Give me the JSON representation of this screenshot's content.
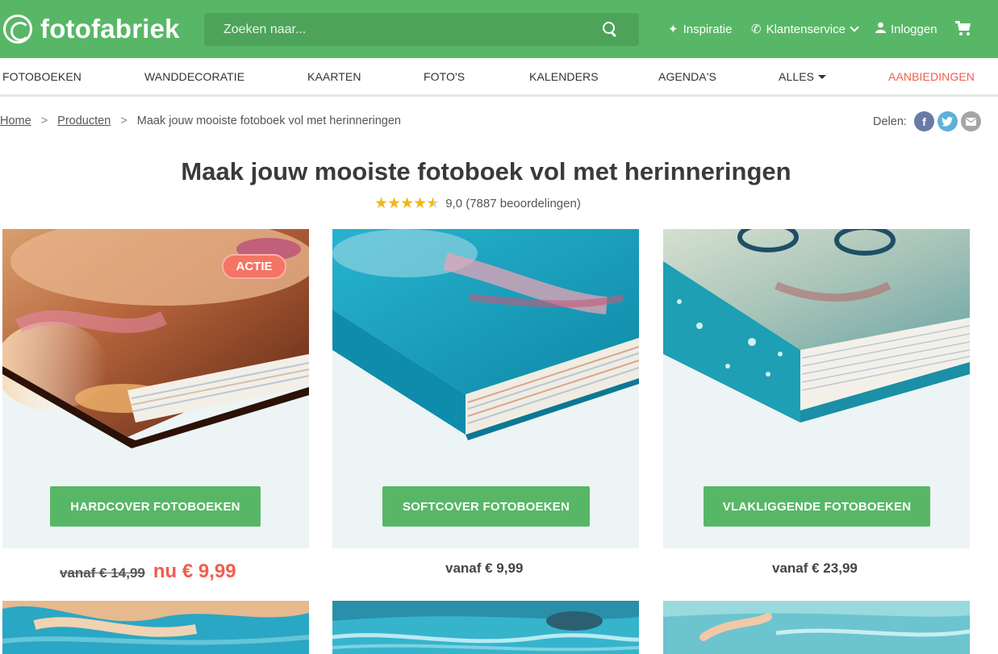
{
  "header": {
    "logo": "fotofabriek",
    "search_placeholder": "Zoeken naar...",
    "inspiratie": "Inspiratie",
    "klantenservice": "Klantenservice",
    "inloggen": "Inloggen"
  },
  "categories": [
    "FOTOBOEKEN",
    "WANDDECORATIE",
    "KAARTEN",
    "FOTO'S",
    "KALENDERS",
    "AGENDA'S",
    "ALLES",
    "AANBIEDINGEN"
  ],
  "breadcrumb": {
    "home": "Home",
    "producten": "Producten",
    "current": "Maak jouw mooiste fotoboek vol met herinneringen",
    "sep": ">"
  },
  "share": {
    "label": "Delen:"
  },
  "page": {
    "title": "Maak jouw mooiste fotoboek vol met herinneringen",
    "rating_text": "9,0 (7887 beoordelingen)",
    "rating_value": 4.5
  },
  "products": [
    {
      "button": "HARDCOVER FOTOBOEKEN",
      "badge": "ACTIE",
      "price_old": "vanaf € 14,99",
      "price_now": "nu € 9,99"
    },
    {
      "button": "SOFTCOVER FOTOBOEKEN",
      "price": "vanaf € 9,99"
    },
    {
      "button": "VLAKLIGGENDE FOTOBOEKEN",
      "price": "vanaf € 23,99"
    }
  ],
  "colors": {
    "brand_green": "#58b766",
    "sale_red": "#f05d4d",
    "star": "#f1b71a"
  },
  "icons": [
    "search-icon",
    "sparkle-icon",
    "phone-icon",
    "user-icon",
    "cart-icon",
    "facebook-icon",
    "twitter-icon",
    "mail-icon"
  ]
}
